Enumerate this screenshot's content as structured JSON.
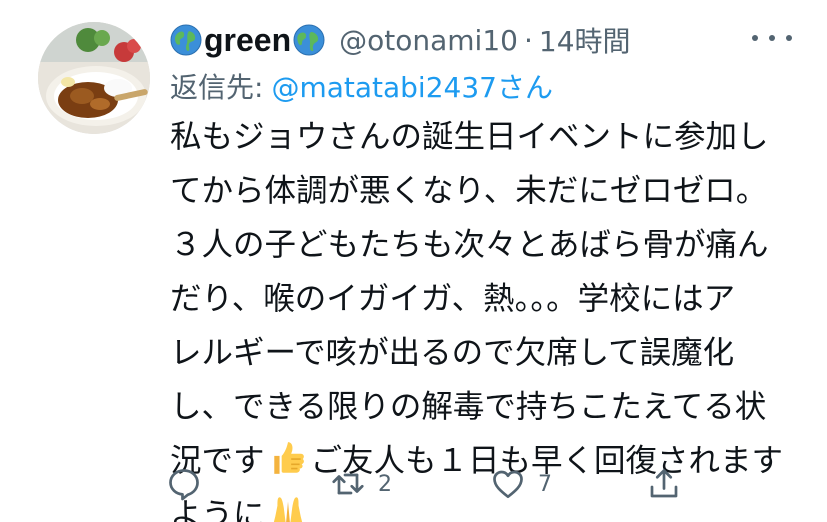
{
  "tweet": {
    "author": {
      "display_name": "green",
      "handle": "@otonami10",
      "separator": "·",
      "time": "14時間"
    },
    "reply_to": {
      "label": "返信先:",
      "target": "@matatabi2437さん"
    },
    "body_lines": [
      "私もジョウさんの誕生日イベントに参加し",
      "てから体調が悪くなり、未だにゼロゼロ。",
      "３人の子どもたちも次々とあばら骨が痛ん",
      "だり、喉のイガイガ、熱。。。学校にはア",
      "レルギーで咳が出るので欠席して誤魔化",
      "し、できる限りの解毒で持ちこたえてる状",
      "況です",
      "ご友人も１日も早く回復されます",
      "ように"
    ],
    "emojis": [
      "thumbs-up-emoji",
      "folded-hands-emoji"
    ],
    "actions": {
      "reply_icon": "reply-icon",
      "retweet_count": "2",
      "like_count": "7",
      "share_icon": "share-icon"
    }
  }
}
